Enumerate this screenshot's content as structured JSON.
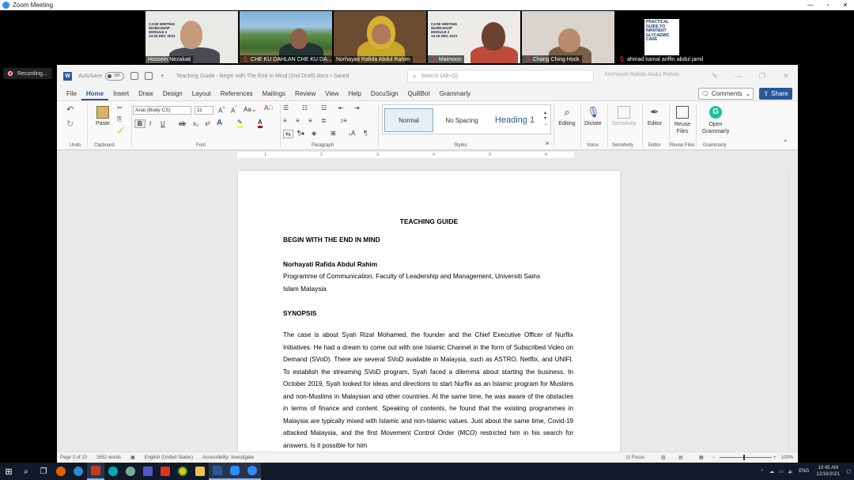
{
  "zoom": {
    "title": "Zoom Meeting",
    "recording_label": "Recording...",
    "participants": [
      {
        "name": "Hossein Nezakati",
        "muted": false,
        "slide": "CASE WRITING\nWORKSHOP\nMODULE 2\n14-16 DEC 2021"
      },
      {
        "name": "CHE KU DAHLAN CHE KU DA...",
        "muted": true
      },
      {
        "name": "Norhayati Rafida Abdul Rahim",
        "muted": false
      },
      {
        "name": "Maimoon",
        "muted": true,
        "slide": "CASE WRITING\nWORKSHOP\nMODULE 2\n14-16 DEC 2021"
      },
      {
        "name": "Chang Ching Hock",
        "muted": true
      },
      {
        "name": "ahmad kamal ariffin abdul jamil",
        "muted": true,
        "book": "PRACTICAL\nGUIDE TO\nINPATIENT\nGLYCAEMIC\nCARE"
      }
    ]
  },
  "word": {
    "autosave": "AutoSave",
    "autosave_state": "Off",
    "doc_title": "Teaching Guide - Begin with The End In Mind (2nd Draft).docx  •  Saved",
    "search_placeholder": "Search (Alt+Q)",
    "user": "Norhayati Rafida Abdul Rahim",
    "tabs": [
      "File",
      "Home",
      "Insert",
      "Draw",
      "Design",
      "Layout",
      "References",
      "Mailings",
      "Review",
      "View",
      "Help",
      "DocuSign",
      "QuillBot",
      "Grammarly"
    ],
    "active_tab": "Home",
    "comments_label": "Comments",
    "share_label": "Share",
    "ribbon": {
      "undo_group": "Undo",
      "clipboard_group": "Clipboard",
      "paste_label": "Paste",
      "font_group": "Font",
      "font_name": "Arial (Body CS)",
      "font_size": "11",
      "paragraph_group": "Paragraph",
      "styles_group": "Styles",
      "style_normal": "Normal",
      "style_nospacing": "No Spacing",
      "style_heading1": "Heading 1",
      "editing_label": "Editing",
      "dictate_label": "Dictate",
      "voice_group": "Voice",
      "sensitivity_label": "Sensitivity",
      "sensitivity_group": "Sensitivity",
      "editor_label": "Editor",
      "editor_group": "Editor",
      "reuse_label": "Reuse Files",
      "reuse_group": "Reuse Files",
      "grammarly_label": "Open Grammarly",
      "grammarly_group": "Grammarly"
    },
    "ruler_marks": [
      "1",
      "2",
      "3",
      "4",
      "5",
      "6"
    ],
    "document": {
      "title": "TEACHING GUIDE",
      "heading": "BEGIN WITH THE END IN MIND",
      "author": "Norhayati Rafida Abdul Rahim",
      "affiliation_1": "Programme of Communication, Faculty of Leadership and Management,  Universiti Sains",
      "affiliation_2": "Islam Malaysia",
      "section": "SYNOPSIS",
      "synopsis": "The case is about Syah Rizal Mohamed, the founder and the Chief Executive Officer of Nurflix Initiatives. He had a dream to come out with one Islamic Channel in the form of Subscribed Video on Demand (SVoD). There are several SVoD available in Malaysia, such as ASTRO, Netflix, and UNIFI. To establish the streaming SVoD program, Syah faced a dilemma about starting the business.  In October 2019, Syah looked for ideas and directions to start Nurflix as an Islamic program for Muslims and non-Muslims in Malaysian and other countries. At the same time, he was aware of the obstacles in terms of finance and content.  Speaking of contents, he found that the existing programmes in Malaysia are typically mixed with Islamic and non-Islamic values. Just about the same time, Covid-19 attacked Malaysia, and the first Movement Control Order (MCO) restricted him in his search for answers.  Is it possible for him"
    },
    "status": {
      "page": "Page 3 of 10",
      "words": "2652 words",
      "language": "English (United States)",
      "accessibility": "Accessibility: Investigate",
      "focus": "Focus",
      "zoom": "100%"
    }
  },
  "taskbar": {
    "lang": "ENG",
    "time": "10:45 AM",
    "date": "12/16/2021"
  }
}
